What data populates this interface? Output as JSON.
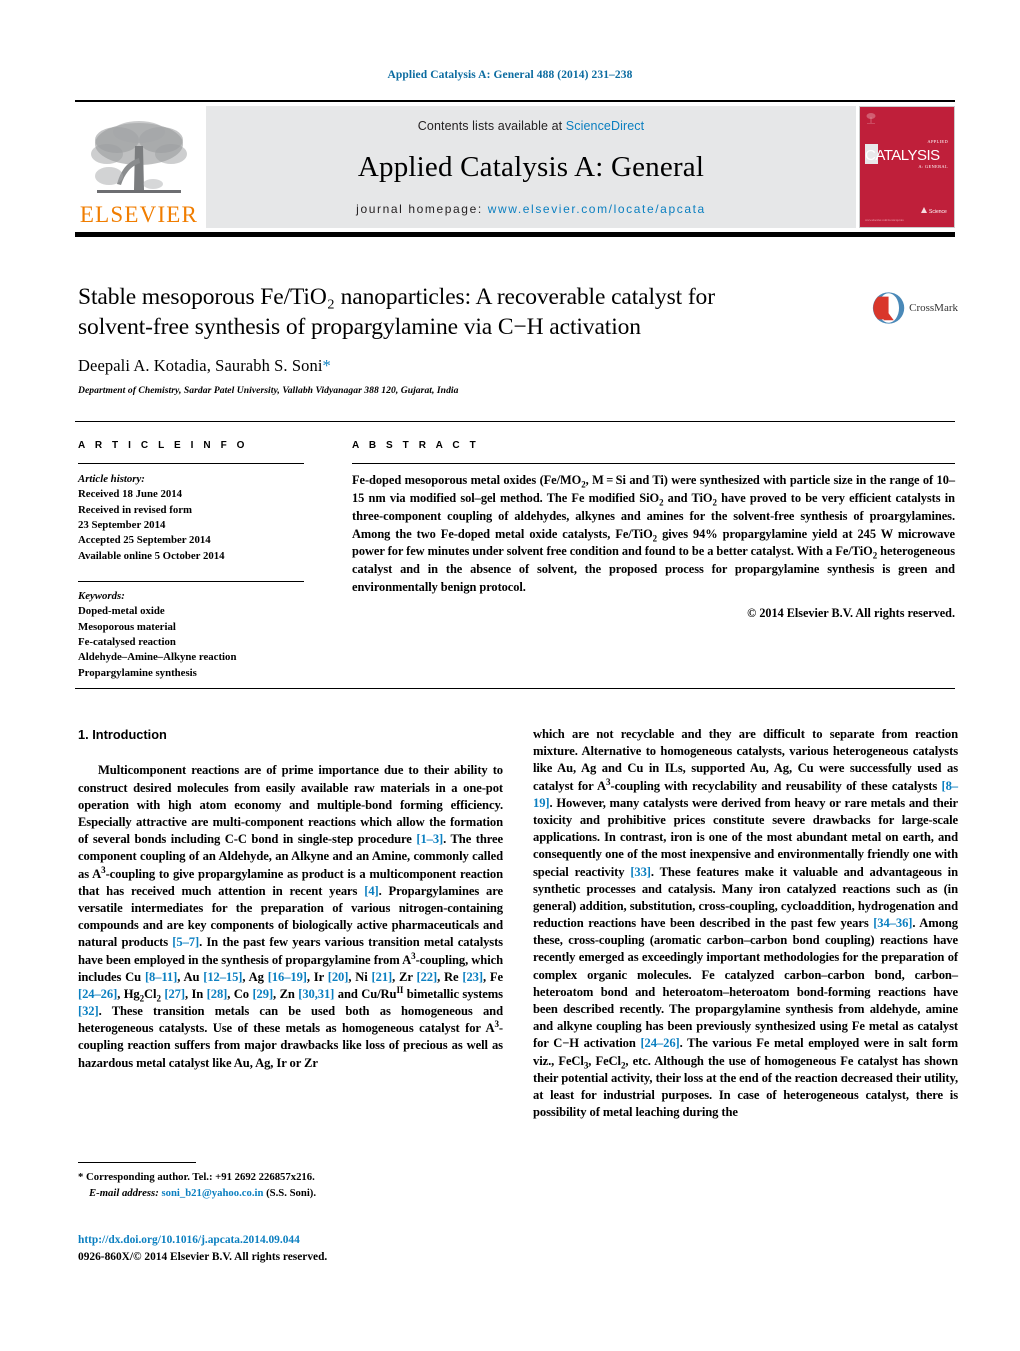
{
  "running_head": "Applied Catalysis A: General 488 (2014) 231–238",
  "masthead": {
    "contents_prefix": "Contents lists available at ",
    "sciencedirect": "ScienceDirect",
    "journal_title": "Applied Catalysis A: General",
    "homepage_prefix": "journal homepage: ",
    "homepage_url": "www.elsevier.com/locate/apcata",
    "publisher": "ELSEVIER",
    "cover": {
      "title": "CATALYSIS",
      "sub_top": "APPLIED",
      "sub_bottom": "A: GENERAL",
      "bottom_note": "Available online at\nScienceDirect",
      "corner_note": "www.elsevier.com/locate/apcata"
    }
  },
  "article": {
    "title_line1": "Stable mesoporous Fe/TiO₂ nanoparticles: A recoverable catalyst for",
    "title_line2": "solvent-free synthesis of propargylamine via C−H activation",
    "authors": "Deepali A. Kotadia, Saurabh S. Soni",
    "author_star": "*",
    "affiliation": "Department of Chemistry, Sardar Patel University, Vallabh Vidyanagar 388 120, Gujarat, India",
    "crossmark_label": "CrossMark"
  },
  "article_info": {
    "heading": "A R T I C L E   I N F O",
    "history_label": "Article history:",
    "history": [
      "Received 18 June 2014",
      "Received in revised form",
      "23 September 2014",
      "Accepted 25 September 2014",
      "Available online 5 October 2014"
    ],
    "keywords_label": "Keywords:",
    "keywords": [
      "Doped-metal oxide",
      "Mesoporous material",
      "Fe-catalysed reaction",
      "Aldehyde–Amine–Alkyne reaction",
      "Propargylamine synthesis"
    ]
  },
  "abstract": {
    "heading": "A B S T R A C T",
    "text_parts": [
      "Fe-doped mesoporous metal oxides (Fe/MO",
      "2",
      ", M = Si and Ti) were synthesized with particle size in the range of 10–15 nm via modified sol–gel method. The Fe modified SiO",
      "2",
      " and TiO",
      "2",
      " have proved to be very efficient catalysts in three-component coupling of aldehydes, alkynes and amines for the solvent-free synthesis of proargylamines. Among the two Fe-doped metal oxide catalysts, Fe/TiO",
      "2",
      " gives 94% propargylamine yield at 245 W microwave power for few minutes under solvent free condition and found to be a better catalyst. With a Fe/TiO",
      "2",
      " heterogeneous catalyst and in the absence of solvent, the proposed process for propargylamine synthesis is green and environmentally benign protocol."
    ],
    "copyright": "© 2014 Elsevier B.V. All rights reserved."
  },
  "introduction": {
    "section_number_title": "1.  Introduction",
    "left_paragraph": {
      "segments": [
        {
          "t": "Multicomponent reactions are of prime importance due to their ability to construct desired molecules from easily available raw materials in a one-pot operation with high atom economy and multiple-bond forming efficiency. Especially attractive are multi-component reactions which allow the formation of several bonds including C-C bond in single-step procedure "
        },
        {
          "t": "[1–3]",
          "k": "ref"
        },
        {
          "t": ". The three component coupling of an Aldehyde, an Alkyne and an Amine, commonly called as A"
        },
        {
          "t": "3",
          "k": "sup"
        },
        {
          "t": "-coupling to give propargylamine as product is a multicomponent reaction that has received much attention in recent years "
        },
        {
          "t": "[4]",
          "k": "ref"
        },
        {
          "t": ". Propargylamines are versatile intermediates for the preparation of various nitrogen-containing compounds and are key components of biologically active pharmaceuticals and natural products "
        },
        {
          "t": "[5–7]",
          "k": "ref"
        },
        {
          "t": ". In the past few years various transition metal catalysts have been employed in the synthesis of propargylamine from A"
        },
        {
          "t": "3",
          "k": "sup"
        },
        {
          "t": "-coupling, which includes Cu "
        },
        {
          "t": "[8–11]",
          "k": "ref"
        },
        {
          "t": ", Au "
        },
        {
          "t": "[12–15]",
          "k": "ref"
        },
        {
          "t": ", Ag "
        },
        {
          "t": "[16–19]",
          "k": "ref"
        },
        {
          "t": ", Ir "
        },
        {
          "t": "[20]",
          "k": "ref"
        },
        {
          "t": ", Ni "
        },
        {
          "t": "[21]",
          "k": "ref"
        },
        {
          "t": ", Zr "
        },
        {
          "t": "[22]",
          "k": "ref"
        },
        {
          "t": ", Re "
        },
        {
          "t": "[23]",
          "k": "ref"
        },
        {
          "t": ", Fe "
        },
        {
          "t": "[24–26]",
          "k": "ref"
        },
        {
          "t": ", Hg"
        },
        {
          "t": "2",
          "k": "sub"
        },
        {
          "t": "Cl"
        },
        {
          "t": "2",
          "k": "sub"
        },
        {
          "t": " "
        },
        {
          "t": "[27]",
          "k": "ref"
        },
        {
          "t": ", In "
        },
        {
          "t": "[28]",
          "k": "ref"
        },
        {
          "t": ", Co "
        },
        {
          "t": "[29]",
          "k": "ref"
        },
        {
          "t": ", Zn "
        },
        {
          "t": "[30,31]",
          "k": "ref"
        },
        {
          "t": " and Cu/Ru"
        },
        {
          "t": "II",
          "k": "sup"
        },
        {
          "t": " bimetallic systems "
        },
        {
          "t": "[32]",
          "k": "ref"
        },
        {
          "t": ". These transition metals can be used both as homogeneous and heterogeneous catalysts. Use of these metals as homogeneous catalyst for A"
        },
        {
          "t": "3",
          "k": "sup"
        },
        {
          "t": "-coupling reaction suffers from major drawbacks like loss of precious as well as hazardous metal catalyst like Au, Ag, Ir or Zr"
        }
      ]
    },
    "right_paragraph": {
      "segments": [
        {
          "t": "which are not recyclable and they are difficult to separate from reaction mixture. Alternative to homogeneous catalysts, various heterogeneous catalysts like Au, Ag and Cu in ILs, supported Au, Ag, Cu were successfully used as catalyst for A"
        },
        {
          "t": "3",
          "k": "sup"
        },
        {
          "t": "-coupling with recyclability and reusability of these catalysts "
        },
        {
          "t": "[8–19]",
          "k": "ref"
        },
        {
          "t": ". However, many catalysts were derived from heavy or rare metals and their toxicity and prohibitive prices constitute severe drawbacks for large-scale applications. In contrast, iron is one of the most abundant metal on earth, and consequently one of the most inexpensive and environmentally friendly one with special reactivity "
        },
        {
          "t": "[33]",
          "k": "ref"
        },
        {
          "t": ". These features make it valuable and advantageous in synthetic processes and catalysis. Many iron catalyzed reactions such as (in general) addition, substitution, cross-coupling, cycloaddition, hydrogenation and reduction reactions have been described in the past few years "
        },
        {
          "t": "[34–36]",
          "k": "ref"
        },
        {
          "t": ". Among these, cross-coupling (aromatic carbon–carbon bond coupling) reactions have recently emerged as exceedingly important methodologies for the preparation of complex organic molecules. Fe catalyzed carbon–carbon bond, carbon–heteroatom bond and heteroatom–heteroatom bond-forming reactions have been described recently. The propargylamine synthesis from aldehyde, amine and alkyne coupling has been previously synthesized using Fe metal as catalyst for C−H activation "
        },
        {
          "t": "[24–26]",
          "k": "ref"
        },
        {
          "t": ". The various Fe metal employed were in salt form viz., FeCl"
        },
        {
          "t": "3",
          "k": "sub"
        },
        {
          "t": ", FeCl"
        },
        {
          "t": "2",
          "k": "sub"
        },
        {
          "t": ", etc. Although the use of homogeneous Fe catalyst has shown their potential activity, their loss at the end of the reaction decreased their utility, at least for industrial purposes. In case of heterogeneous catalyst, there is possibility of metal leaching during the"
        }
      ]
    }
  },
  "footnote": {
    "star": "*",
    "corresponding": "Corresponding author. Tel.: +91 2692 226857x216.",
    "email_label": "E-mail address:",
    "email": "soni_b21@yahoo.co.in",
    "email_owner": "(S.S. Soni)."
  },
  "footer": {
    "doi": "http://dx.doi.org/10.1016/j.apcata.2014.09.044",
    "issn_line": "0926-860X/© 2014 Elsevier B.V. All rights reserved."
  },
  "colors": {
    "link": "#0b7fc0",
    "running_head": "#0b6ba0",
    "elsevier_orange": "#f07d00",
    "cover_red": "#bf1f3a"
  }
}
